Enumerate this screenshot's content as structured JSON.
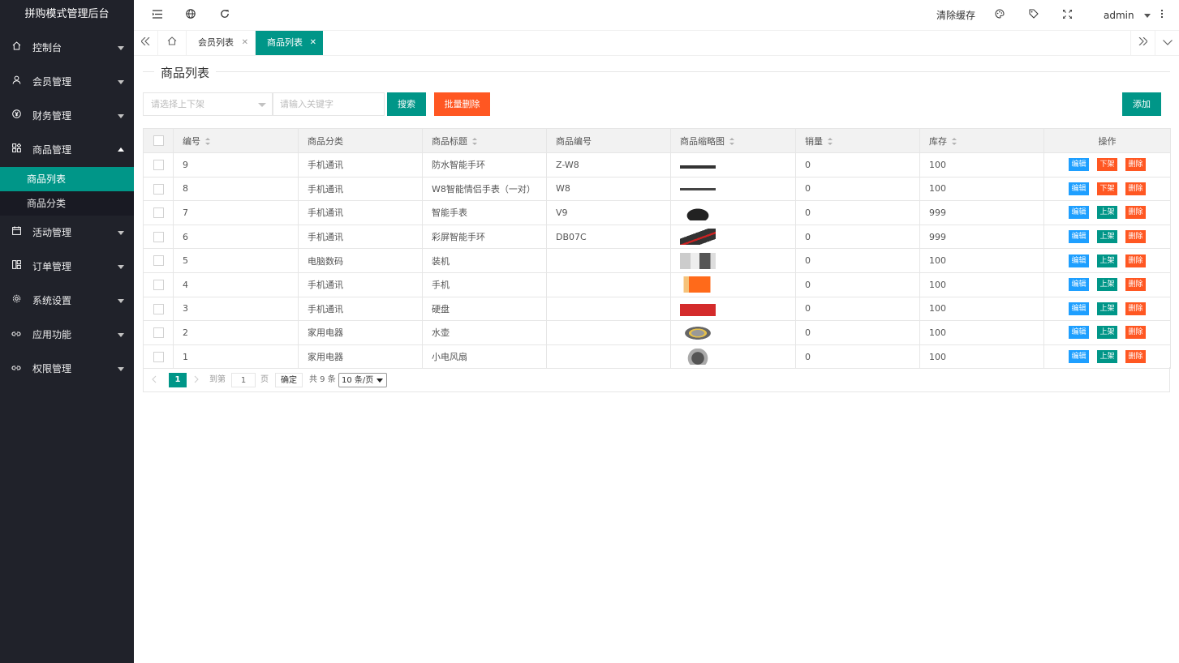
{
  "app_title": "拼购模式管理后台",
  "sidebar": {
    "items": [
      {
        "label": "控制台",
        "icon": "home-icon"
      },
      {
        "label": "会员管理",
        "icon": "user-icon"
      },
      {
        "label": "财务管理",
        "icon": "yen-icon"
      },
      {
        "label": "商品管理",
        "icon": "apps-icon",
        "open": true,
        "children": [
          {
            "label": "商品列表",
            "active": true
          },
          {
            "label": "商品分类"
          }
        ]
      },
      {
        "label": "活动管理",
        "icon": "calendar-icon"
      },
      {
        "label": "订单管理",
        "icon": "template-icon"
      },
      {
        "label": "系统设置",
        "icon": "gear-icon"
      },
      {
        "label": "应用功能",
        "icon": "link-icon"
      },
      {
        "label": "权限管理",
        "icon": "link-icon"
      }
    ]
  },
  "header": {
    "clear_cache": "清除缓存",
    "user": "admin"
  },
  "tabs": [
    {
      "label": "会员列表",
      "active": false
    },
    {
      "label": "商品列表",
      "active": true
    }
  ],
  "page": {
    "legend": "商品列表",
    "select_placeholder": "请选择上下架",
    "search_placeholder": "请输入关键字",
    "search_btn": "搜索",
    "batch_delete_btn": "批量删除",
    "add_btn": "添加"
  },
  "table": {
    "columns": [
      "编号",
      "商品分类",
      "商品标题",
      "商品编号",
      "商品缩略图",
      "销量",
      "库存",
      "操作"
    ],
    "rows": [
      {
        "id": "9",
        "category": "手机通讯",
        "title": "防水智能手环",
        "code": "Z-W8",
        "sales": "0",
        "stock": "100",
        "shelf": "下架"
      },
      {
        "id": "8",
        "category": "手机通讯",
        "title": "W8智能情侣手表（一对）",
        "code": "W8",
        "sales": "0",
        "stock": "100",
        "shelf": "下架"
      },
      {
        "id": "7",
        "category": "手机通讯",
        "title": "智能手表",
        "code": "V9",
        "sales": "0",
        "stock": "999",
        "shelf": "上架"
      },
      {
        "id": "6",
        "category": "手机通讯",
        "title": "彩屏智能手环",
        "code": "DB07C",
        "sales": "0",
        "stock": "999",
        "shelf": "上架"
      },
      {
        "id": "5",
        "category": "电脑数码",
        "title": "装机",
        "code": "",
        "sales": "0",
        "stock": "100",
        "shelf": "上架"
      },
      {
        "id": "4",
        "category": "手机通讯",
        "title": "手机",
        "code": "",
        "sales": "0",
        "stock": "100",
        "shelf": "上架"
      },
      {
        "id": "3",
        "category": "手机通讯",
        "title": "硬盘",
        "code": "",
        "sales": "0",
        "stock": "100",
        "shelf": "上架"
      },
      {
        "id": "2",
        "category": "家用电器",
        "title": "水壶",
        "code": "",
        "sales": "0",
        "stock": "100",
        "shelf": "上架"
      },
      {
        "id": "1",
        "category": "家用电器",
        "title": "小电风扇",
        "code": "",
        "sales": "0",
        "stock": "100",
        "shelf": "上架"
      }
    ],
    "actions": {
      "edit": "编辑",
      "delete": "删除"
    }
  },
  "pager": {
    "current": "1",
    "goto_label": "到第",
    "goto_value": "1",
    "page_unit": "页",
    "confirm": "确定",
    "total": "共 9 条",
    "page_size": "10 条/页"
  },
  "colors": {
    "primary": "#009688",
    "danger": "#FF5722",
    "edit": "#1E9FFF",
    "sidebar": "#20222a"
  }
}
